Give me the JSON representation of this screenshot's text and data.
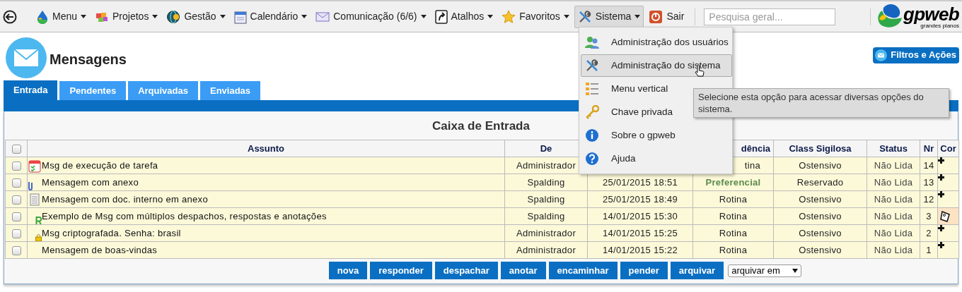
{
  "nav": {
    "items": [
      {
        "kind": "drop",
        "label": "Menu",
        "caret": true,
        "active": false
      },
      {
        "kind": "puzzle",
        "label": "Projetos",
        "caret": true,
        "active": false
      },
      {
        "kind": "globe",
        "label": "Gestão",
        "caret": true,
        "active": false
      },
      {
        "kind": "calendar",
        "label": "Calendário",
        "caret": true,
        "active": false
      },
      {
        "kind": "envelope",
        "label": "Comunicação (6/6)",
        "caret": true,
        "active": false
      },
      {
        "kind": "shortcut",
        "label": "Atalhos",
        "caret": true,
        "active": false
      },
      {
        "kind": "star",
        "label": "Favoritos",
        "caret": true,
        "active": false
      },
      {
        "kind": "tools",
        "label": "Sistema",
        "caret": true,
        "active": true
      },
      {
        "kind": "power",
        "label": "Sair",
        "caret": false,
        "active": false
      }
    ],
    "search": {
      "placeholder": "Pesquisa geral..."
    },
    "logo": {
      "name": "gpweb",
      "tagline": "grandes planos"
    }
  },
  "page": {
    "title": "Mensagens",
    "action_button": "Filtros e Ações"
  },
  "tabs": [
    {
      "label": "Entrada",
      "selected": true
    },
    {
      "label": "Pendentes",
      "selected": false
    },
    {
      "label": "Arquivadas",
      "selected": false
    },
    {
      "label": "Enviadas",
      "selected": false
    }
  ],
  "table": {
    "title": "Caixa de Entrada",
    "columns": [
      "Assunto",
      "De",
      "",
      "dência",
      "Class Sigilosa",
      "Status",
      "Nr",
      "Cor"
    ],
    "rows": [
      {
        "checked": false,
        "kind": "task",
        "subject": "Msg de execução de tarefa",
        "from": "Administrador",
        "date": "",
        "precedence": "tina",
        "urgent": false,
        "class": "Ostensivo",
        "status": "Não Lida",
        "nr": "14",
        "cor": {
          "kind": "plus"
        }
      },
      {
        "checked": false,
        "kind": "clip",
        "subject": "Mensagem com anexo",
        "from": "Spalding",
        "date": "25/01/2015 18:51",
        "precedence": "Preferencial",
        "urgent": true,
        "class": "Reservado",
        "status": "Não Lida",
        "nr": "13",
        "cor": {
          "kind": "plus"
        }
      },
      {
        "checked": false,
        "kind": "doc",
        "subject": "Mensagem com doc. interno em anexo",
        "from": "Spalding",
        "date": "25/01/2015 18:49",
        "precedence": "Rotina",
        "urgent": false,
        "class": "Ostensivo",
        "status": "Não Lida",
        "nr": "12",
        "cor": {
          "kind": "plus"
        }
      },
      {
        "checked": false,
        "kind": "reply",
        "subject": "Exemplo de Msg com múltiplos despachos, respostas e anotações",
        "from": "Spalding",
        "date": "14/01/2015 15:30",
        "precedence": "Rotina",
        "urgent": false,
        "class": "Ostensivo",
        "status": "Não Lida",
        "nr": "3",
        "cor": {
          "kind": "tag",
          "color": "#fbe3c4"
        }
      },
      {
        "checked": false,
        "kind": "lock",
        "subject": "Msg criptografada. Senha: brasil",
        "from": "Administrador",
        "date": "14/01/2015 15:25",
        "precedence": "Rotina",
        "urgent": false,
        "class": "Ostensivo",
        "status": "Não Lida",
        "nr": "2",
        "cor": {
          "kind": "plus"
        }
      },
      {
        "checked": false,
        "kind": "plain",
        "subject": "Mensagem de boas-vindas",
        "from": "Administrador",
        "date": "14/01/2015 15:22",
        "precedence": "Rotina",
        "urgent": false,
        "class": "Ostensivo",
        "status": "Não Lida",
        "nr": "1",
        "cor": {
          "kind": "plus"
        }
      }
    ],
    "all_checked": false,
    "buttons": [
      "nova",
      "responder",
      "despachar",
      "anotar",
      "encaminhar",
      "pender",
      "arquivar"
    ],
    "archive_select": "arquivar em"
  },
  "dropdown": {
    "items": [
      {
        "kind": "users",
        "label": "Administração dos usuários",
        "highlighted": false
      },
      {
        "kind": "tools",
        "label": "Administração do sistema",
        "highlighted": true
      },
      {
        "kind": "tree",
        "label": "Menu vertical",
        "highlighted": false
      },
      {
        "kind": "key",
        "label": "Chave privada",
        "highlighted": false
      },
      {
        "kind": "info",
        "label": "Sobre o gpweb",
        "highlighted": false
      },
      {
        "kind": "help",
        "label": "Ajuda",
        "highlighted": false
      }
    ],
    "tooltip": "Selecione esta opção para acessar diversas opções do sistema."
  }
}
